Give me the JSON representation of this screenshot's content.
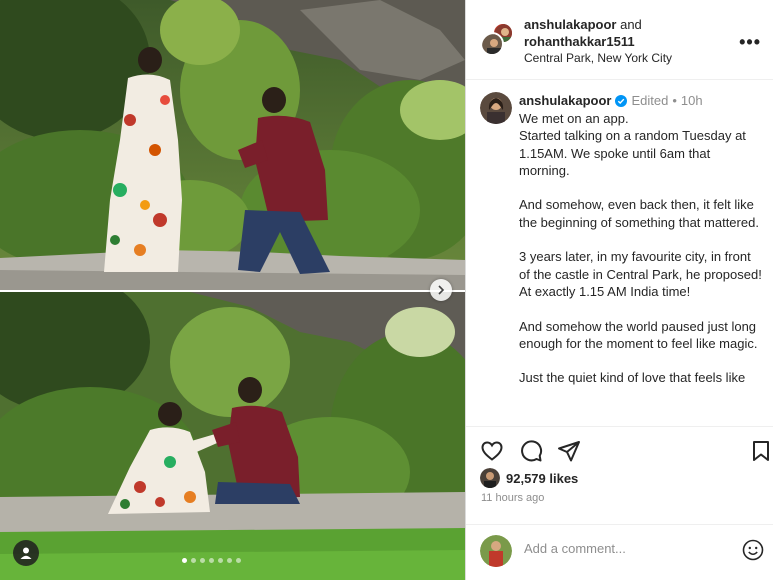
{
  "header": {
    "user1": "anshulakapoor",
    "and_text": "and",
    "user2": "rohanthakkar1511",
    "location": "Central Park, New York City",
    "more_icon": "more-horizontal-icon"
  },
  "caption": {
    "username": "anshulakapoor",
    "verified_icon": "verified-badge-icon",
    "edited": "Edited",
    "separator": "•",
    "time": "10h",
    "paragraphs": [
      "We met on an app.\nStarted talking on a random Tuesday at 1.15AM. We spoke until 6am that morning.",
      "And somehow, even back then, it felt like the beginning of something that mattered.",
      "3 years later, in my favourite city, in front of the castle in Central Park, he proposed! At exactly 1.15 AM India time!",
      "And somehow the world paused just long enough for the moment to feel like magic.",
      "Just the quiet kind of love that feels like"
    ]
  },
  "actions": {
    "like_icon": "heart-icon",
    "comment_icon": "comment-icon",
    "share_icon": "send-icon",
    "save_icon": "bookmark-icon"
  },
  "likes": "92,579 likes",
  "timestamp": "11 hours ago",
  "comment": {
    "placeholder": "Add a comment...",
    "emoji_icon": "emoji-icon"
  },
  "carousel": {
    "total_slides": 7,
    "active_slide": 1,
    "next_icon": "chevron-right-icon",
    "tag_icon": "user-tag-icon"
  },
  "colors": {
    "verified": "#0095f6",
    "muted": "#8e8e8e",
    "border": "#dbdbdb"
  }
}
